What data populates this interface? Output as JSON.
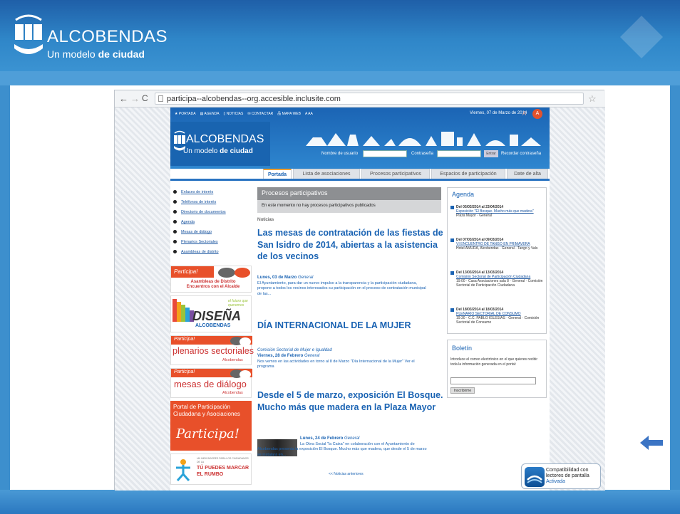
{
  "slide": {
    "logo_title": "ALCOBENDAS",
    "logo_tag_prefix": "Un modelo ",
    "logo_tag_bold": "de ciudad",
    "accent": "#2f86c8"
  },
  "browser": {
    "url": "participa--alcobendas--org.accesible.inclusite.com",
    "back": "←",
    "forward": "→",
    "reload": "C",
    "star": "☆"
  },
  "site": {
    "topnav": [
      "★ PORTADA",
      "▤ AGENDA",
      "▯ NOTICIAS",
      "✉ CONTACTAR",
      "品 MAPA WEB",
      "A AA"
    ],
    "date": "Viernes, 07 de Marzo de 2014",
    "aa_badge": "A",
    "aa_small": "A",
    "logo_title": "ALCOBENDAS",
    "logo_tag_prefix": "Un modelo ",
    "logo_tag_bold": "de ciudad",
    "login": {
      "user_label": "Nombre de usuario",
      "pass_label": "Contraseña",
      "enter_button": "Entrar",
      "recover": "Recordar contraseña"
    },
    "tabs": [
      "Portada",
      "Lista de asociaciones",
      "Procesos participativos",
      "Espacios de participación",
      "Date de alta"
    ],
    "leftnav": [
      "Enlaces de interés",
      "Teléfonos de interés",
      "Directorio de documentos",
      "Agenda",
      "Mesas de diálogo",
      "Plenarios Sectoriales",
      "Asambleas de distrito"
    ],
    "promos": {
      "asambleas_head": "Participa!",
      "asambleas_line1": "Asambleas de Distrito",
      "asambleas_line2": "Encuentros con el Alcalde",
      "disena_main": "DISEÑA",
      "disena_sub": "ALCOBENDAS",
      "disena_note": "el futuro que queremos",
      "plenarios_tag": "Participa!",
      "plenarios_main": "plenarios sectoriales",
      "plenarios_sub": "Alcobendas",
      "mesas_tag": "Participa!",
      "mesas_main": "mesas de diálogo",
      "mesas_sub": "Alcobendas",
      "portal_line1": "Portal de Participación",
      "portal_line2": "Ciudadana y Asociaciones",
      "portal_script": "Participa!",
      "rumbo_small": "UN INDICADORES PARA LOS CIUDADANOS DE LA",
      "rumbo_line1": "TÚ PUEDES MARCAR",
      "rumbo_line2": "EL RUMBO"
    },
    "procesos_title": "Procesos participativos",
    "procesos_msg": "En este momento no hay procesos participativos publicados",
    "noticias_label": "Noticias",
    "news": [
      {
        "title": "Las mesas de contratación de las fiestas de San Isidro de 2014, abiertas a la asistencia de los vecinos",
        "date": "Lunes, 03 de Marzo",
        "category": "General",
        "body": "El Ayuntamiento, para dar un nuevo impulso a la transparencia y la participación ciudadana, propone a todos los vecinos interesados su participación en el proceso de contratación municipal de las..."
      },
      {
        "title": "DÍA INTERNACIONAL DE LA MUJER",
        "pre": "Comisión Sectorial de Mujer e Igualdad",
        "date": "Viernes, 28 de Febrero",
        "category": "General",
        "body": "Nos vemos en las actividades en torno al 8 de Marzo \"Día Internacional de la Mujer\" Ver el programa"
      },
      {
        "title": "Desde el 5 de marzo, exposición El Bosque. Mucho más que madera en la Plaza Mayor",
        "date": "Lunes, 24 de Febrero",
        "category": "General",
        "body": "La Obra Social \"la Caixa\" en colaboración con el Ayuntamiento de Alcobendas presenta la exposición El Bosque. Mucho más que madera, que desde el 5 de marzo se instalará en..."
      }
    ],
    "prev_news": "<< Noticias anteriores",
    "agenda": {
      "title": "Agenda",
      "items": [
        {
          "dates": "Del 05/03/2014 al 23/04/2014",
          "link": "Exposición \"El Bosque. Mucho más que madera\"",
          "info": "Plaza Mayor · General"
        },
        {
          "dates": "Del 07/03/2014 al 09/03/2014",
          "link": "VI ENCUENTRO DE TANGO EN PRIMAVERA",
          "info": "Hotel AMURA, Alcobendas · General · Tango y Vals"
        },
        {
          "dates": "Del 13/03/2014 al 13/03/2014",
          "link": "Comisión Sectorial de Participación Ciudadana",
          "info": "19:00 · Casa Asociaciones sala 8 · General · Comisión Sectorial de Participación Ciudadana"
        },
        {
          "dates": "Del 18/03/2014 al 18/03/2014",
          "link": "PLENARIO SECTORIAL DE CONSUMO",
          "info": "19:30 · C.C. PABLO IGLESIAS · General · Comisión Sectorial de Consumo"
        }
      ]
    },
    "boletin": {
      "title": "Boletín",
      "text": "Introduce el correo electrónico en el que quieres recibir toda la información generada en el portal:",
      "button": "Inscribirme"
    }
  },
  "compat": {
    "line1": "Compatibilidad con",
    "line2": "lectores de pantalla",
    "status": "Activada"
  }
}
